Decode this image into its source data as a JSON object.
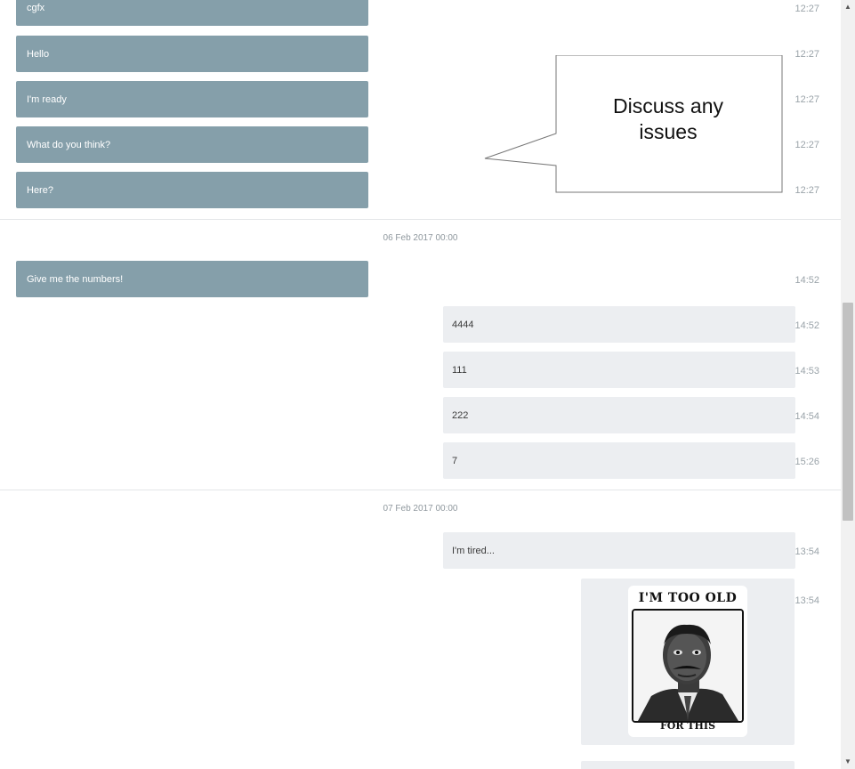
{
  "messages_group1": [
    {
      "text": "cgfx",
      "time": "12:27"
    },
    {
      "text": "Hello",
      "time": "12:27"
    },
    {
      "text": "I'm ready",
      "time": "12:27"
    },
    {
      "text": "What do you think?",
      "time": "12:27"
    },
    {
      "text": "Here?",
      "time": "12:27"
    }
  ],
  "date_sep_1": "06 Feb 2017 00:00",
  "messages_group2": [
    {
      "text": "Give me the numbers!",
      "time": "14:52",
      "side": "in"
    },
    {
      "text": "4444",
      "time": "14:52",
      "side": "out"
    },
    {
      "text": "111",
      "time": "14:53",
      "side": "out"
    },
    {
      "text": "222",
      "time": "14:54",
      "side": "out"
    },
    {
      "text": "7",
      "time": "15:26",
      "side": "out"
    }
  ],
  "date_sep_2": "07 Feb 2017 00:00",
  "messages_group3": [
    {
      "text": "I'm tired...",
      "time": "13:54",
      "side": "out"
    },
    {
      "time": "13:54",
      "side": "out"
    }
  ],
  "sticker": {
    "top_text": "I'M TOO OLD",
    "bottom_text": "FOR THIS"
  },
  "callout": {
    "line1": "Discuss any",
    "line2": "issues"
  },
  "colors": {
    "incoming_bubble": "#859faa",
    "outgoing_bubble": "#eceef1",
    "time_text": "#9aa3a9"
  }
}
